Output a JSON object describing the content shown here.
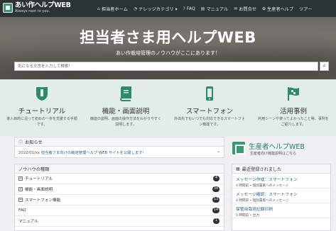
{
  "nav": {
    "logo_title": "あい作ヘルプWEB",
    "logo_sub": "Always next to you.",
    "items": [
      {
        "label": "担当者ホーム",
        "icon": "home-icon"
      },
      {
        "label": "ナレッジカテゴリ ▾",
        "icon": "knowledge-icon"
      },
      {
        "label": "FAQ",
        "icon": "question-icon"
      },
      {
        "label": "マニュアル",
        "icon": "book-icon"
      },
      {
        "label": "お問合せ",
        "icon": "mail-icon"
      },
      {
        "label": "生産者ヘルプ",
        "icon": "leaf-icon"
      },
      {
        "label": "ツアー",
        "icon": ""
      }
    ]
  },
  "hero": {
    "title": "担当者さま用ヘルプWEB",
    "subtitle": "あい作栽培管理のノウハウがここにあります！",
    "search_placeholder": "気になる文言を入力して検索！",
    "search_button": "⌕"
  },
  "features": [
    {
      "title": "チュートリアル",
      "desc": "導入目的に沿って初めの一歩を支援する手順です。",
      "icon": "shield-icon"
    },
    {
      "title": "機能・画面説明",
      "desc": "機能の説明、画面の操作方法をわかりやすく説明します。",
      "icon": "book-icon"
    },
    {
      "title": "スマートフォン",
      "desc": "外出先でもいつでも対応できるスマートフォン機能です。",
      "icon": "smartphone-icon"
    },
    {
      "title": "活用事例",
      "desc": "利用シーンや使ってよかったこと等、事例をご紹介します。",
      "icon": "flag-icon"
    }
  ],
  "notice": {
    "heading": "お知らせ",
    "date": "2022/01/xx",
    "text": "担当者さま向けの栽培管理ヘルプ WEB サイトを公開します！"
  },
  "knowhow": {
    "heading": "ノウハウの種類",
    "items": [
      {
        "label": "チュートリアル",
        "count": "4",
        "expandable": true
      },
      {
        "label": "機能・画面説明",
        "count": "34",
        "expandable": true
      },
      {
        "label": "スマートフォン機能",
        "count": "13",
        "expandable": true
      },
      {
        "label": "FAQ",
        "count": "14",
        "expandable": false
      },
      {
        "label": "マニュアル",
        "count": "1",
        "expandable": false
      }
    ]
  },
  "seisan": {
    "title": "生産者ヘルプWEB",
    "subtitle": "生産者向け機能説明はこちら"
  },
  "recent": {
    "heading": "最近登録されました",
    "items": [
      {
        "title": "メッセージ作成：スマートフォン",
        "meta": "4 時間前 • 個別農家へのメッセージ"
      },
      {
        "title": "メッセージ確認：スマートフォン",
        "meta": "4 時間前 • 個別農家へのメッセージ"
      },
      {
        "title": "保管用栽培記録印刷",
        "meta": "5 時間前 • 出力"
      }
    ]
  }
}
